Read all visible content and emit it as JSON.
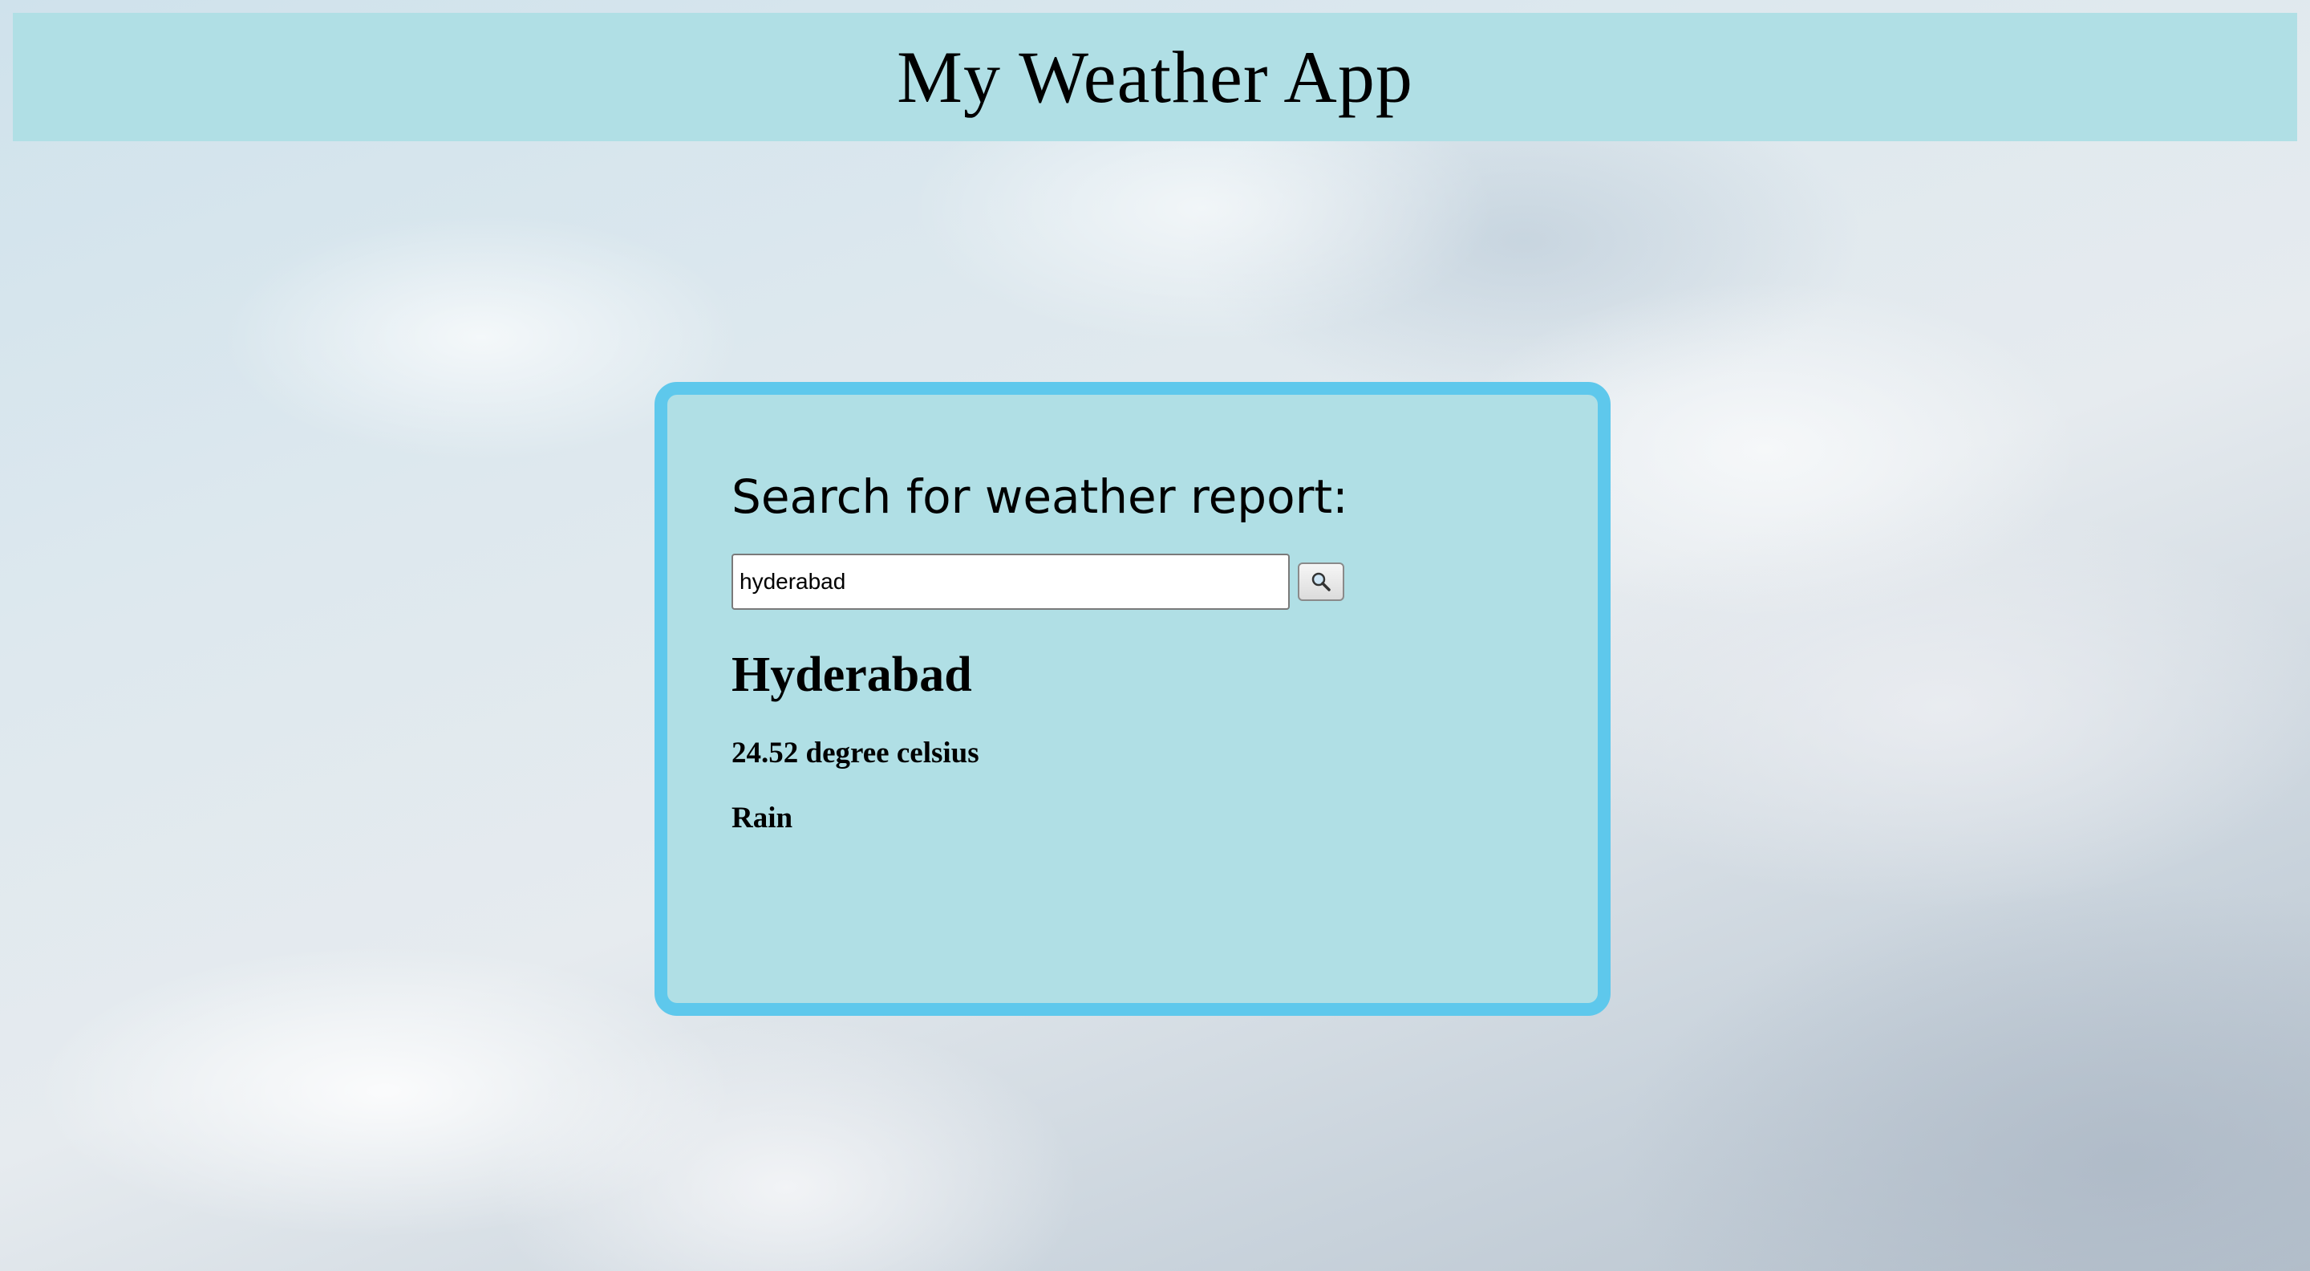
{
  "header": {
    "title": "My Weather App",
    "background_color": "#b0dfe5"
  },
  "card": {
    "heading": "Search for weather report:",
    "background_color": "#b0dfe5",
    "border_color": "#5ec8ec"
  },
  "search": {
    "value": "hyderabad",
    "button_icon": "search-icon"
  },
  "weather": {
    "city": "Hyderabad",
    "temperature": "24.52 degree celsius",
    "condition": "Rain"
  }
}
